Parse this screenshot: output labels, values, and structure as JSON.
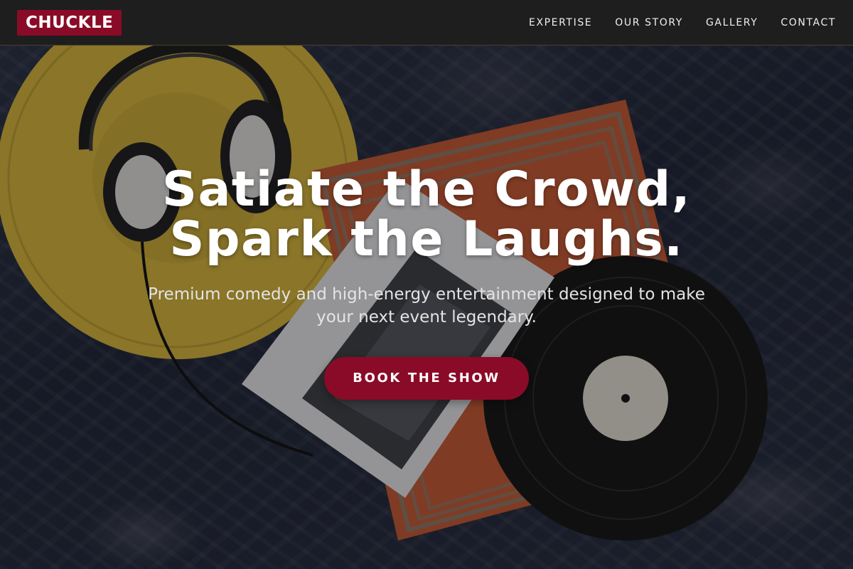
{
  "nav": {
    "logo": "CHUCKLE",
    "links": [
      {
        "label": "EXPERTISE"
      },
      {
        "label": "OUR STORY"
      },
      {
        "label": "GALLERY"
      },
      {
        "label": "CONTACT"
      }
    ]
  },
  "hero": {
    "title_line_1": "Satiate the Crowd,",
    "title_line_2": "Spark the Laughs.",
    "subtitle": "Premium comedy and high-energy entertainment designed to make your next event legendary.",
    "cta_label": "BOOK THE SHOW",
    "background_image": "headphones-vinyl-record-magazine-on-rug-photo"
  },
  "colors": {
    "brand": "#8a0b27",
    "nav_background": "#1e1e1e",
    "text": "#ffffff"
  }
}
